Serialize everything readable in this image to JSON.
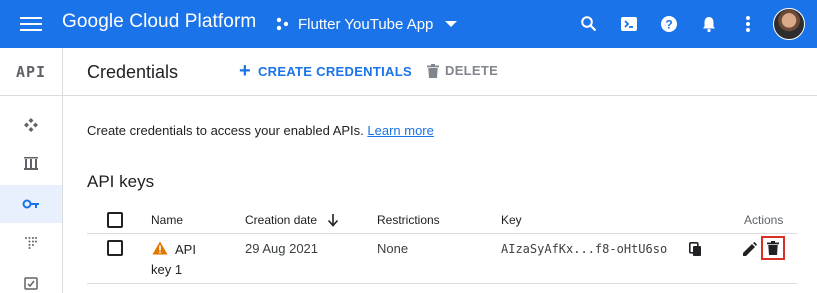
{
  "topbar": {
    "brand": "Google Cloud Platform",
    "project_name": "Flutter YouTube App",
    "icons": [
      "menu-icon",
      "search-icon",
      "cloud-shell-icon",
      "help-icon",
      "notifications-icon",
      "more-vert-icon"
    ],
    "accent_color": "#1a73e8"
  },
  "rail": {
    "logo": "API",
    "items": [
      "dashboard-icon",
      "library-icon",
      "credentials-key-icon",
      "oauth-consent-icon",
      "domain-verification-icon"
    ],
    "active_item": "credentials-key-icon"
  },
  "header": {
    "title": "Credentials",
    "create_label": "CREATE CREDENTIALS",
    "delete_label": "DELETE"
  },
  "intro": {
    "text": "Create credentials to access your enabled APIs.",
    "link": "Learn more"
  },
  "api_keys": {
    "section_title": "API keys",
    "columns": {
      "name": "Name",
      "creation_date": "Creation date",
      "restrictions": "Restrictions",
      "key": "Key",
      "actions": "Actions"
    },
    "rows": [
      {
        "name_line1": "API",
        "name_line2": "key 1",
        "creation_date": "29 Aug 2021",
        "restrictions": "None",
        "key": "AIzaSyAfKx...f8-oHtU6so",
        "warning": true
      }
    ]
  }
}
